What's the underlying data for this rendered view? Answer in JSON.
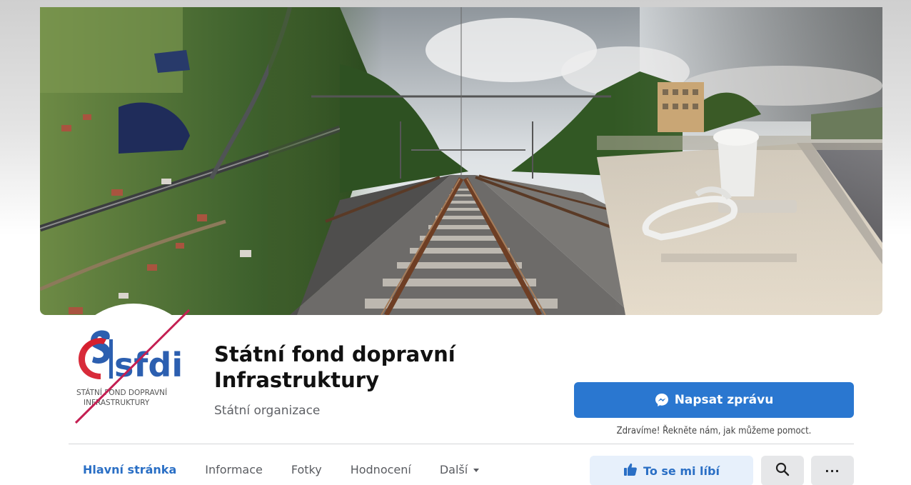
{
  "page": {
    "name": "Státní fond dopravní Infrastruktury",
    "category": "Státní organizace"
  },
  "logo": {
    "wordmark": "sfdi",
    "line1": "STÁTNÍ FOND DOPRAVNÍ",
    "line2": "INFRASTRUKTURY"
  },
  "actions": {
    "message_label": "Napsat zprávu",
    "greeting": "Zdravíme! Řekněte nám, jak můžeme pomoct.",
    "like_label": "To se mi líbí",
    "more_label": "···"
  },
  "tabs": [
    {
      "label": "Hlavní stránka",
      "active": true
    },
    {
      "label": "Informace",
      "active": false
    },
    {
      "label": "Fotky",
      "active": false
    },
    {
      "label": "Hodnocení",
      "active": false
    },
    {
      "label": "Další",
      "active": false
    }
  ],
  "colors": {
    "primary": "#2a77d0",
    "active_tab": "#2a6fc5",
    "logo_blue": "#2c5fb0",
    "logo_red": "#d6202f",
    "strike_line": "#c41f52"
  },
  "icons": {
    "message": "messenger-icon",
    "like": "thumbs-up-icon",
    "search": "search-icon",
    "more": "more-icon",
    "dropdown": "chevron-down-icon"
  }
}
